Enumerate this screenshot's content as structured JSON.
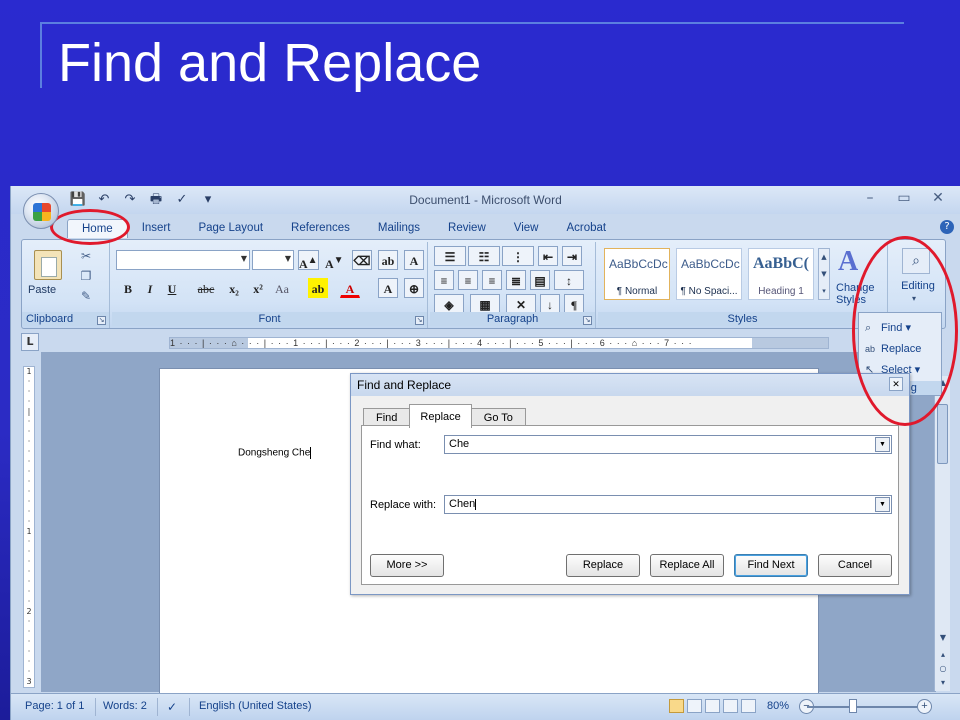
{
  "slide": {
    "title": "Find and Replace"
  },
  "window": {
    "title": "Document1 - Microsoft Word",
    "controls": [
      "–",
      "▭",
      "✕"
    ]
  },
  "quick_access": [
    "💾",
    "↶",
    "↷",
    "🖶",
    "✓",
    "▾"
  ],
  "ribbon": {
    "tabs": [
      "Home",
      "Insert",
      "Page Layout",
      "References",
      "Mailings",
      "Review",
      "View",
      "Acrobat"
    ],
    "active_tab": "Home",
    "groups": {
      "clipboard": {
        "label": "Clipboard",
        "paste": "Paste"
      },
      "font": {
        "label": "Font",
        "font_name": "",
        "font_size": "",
        "buttons": [
          "B",
          "I",
          "U",
          "abc",
          "x₂",
          "x²",
          "Aa"
        ]
      },
      "paragraph": {
        "label": "Paragraph"
      },
      "styles": {
        "label": "Styles",
        "items": [
          {
            "sample": "AaBbCcDc",
            "name": "¶ Normal"
          },
          {
            "sample": "AaBbCcDc",
            "name": "¶ No Spaci..."
          },
          {
            "sample": "AaBbC(",
            "name": "Heading 1"
          }
        ],
        "change_styles": "Change Styles"
      },
      "editing": {
        "label": "Editing"
      }
    }
  },
  "editing_menu": {
    "items": [
      {
        "label": "Find",
        "icon": "binoculars-icon",
        "glyph": "⌕"
      },
      {
        "label": "Replace",
        "icon": "replace-icon",
        "glyph": "ab"
      },
      {
        "label": "Select",
        "icon": "cursor-icon",
        "glyph": "↖"
      }
    ],
    "group_label": "Editing"
  },
  "ruler": {
    "text": "1 · · · | · · · ⌂ · · · | · · · 1 · · · | · · · 2 · · · | · · · 3 · · · | · · · 4 · · · | · · · 5 · · · | · · · 6 · · · ⌂ · · · 7 · · ·"
  },
  "document": {
    "text": "Dongsheng Che"
  },
  "dialog": {
    "title": "Find and Replace",
    "tabs": [
      "Find",
      "Replace",
      "Go To"
    ],
    "active_tab": "Replace",
    "find_label": "Find what:",
    "find_value": "Che",
    "replace_label": "Replace with:",
    "replace_value": "Chen",
    "buttons": {
      "more": "More >>",
      "replace": "Replace",
      "replace_all": "Replace All",
      "find_next": "Find Next",
      "cancel": "Cancel"
    }
  },
  "status_bar": {
    "page": "Page: 1 of 1",
    "words": "Words: 2",
    "language": "English (United States)",
    "zoom": "80%"
  },
  "colors": {
    "slide_bg": "#2a2acf",
    "callout": "#e0192c",
    "ribbon_text": "#15428b"
  }
}
